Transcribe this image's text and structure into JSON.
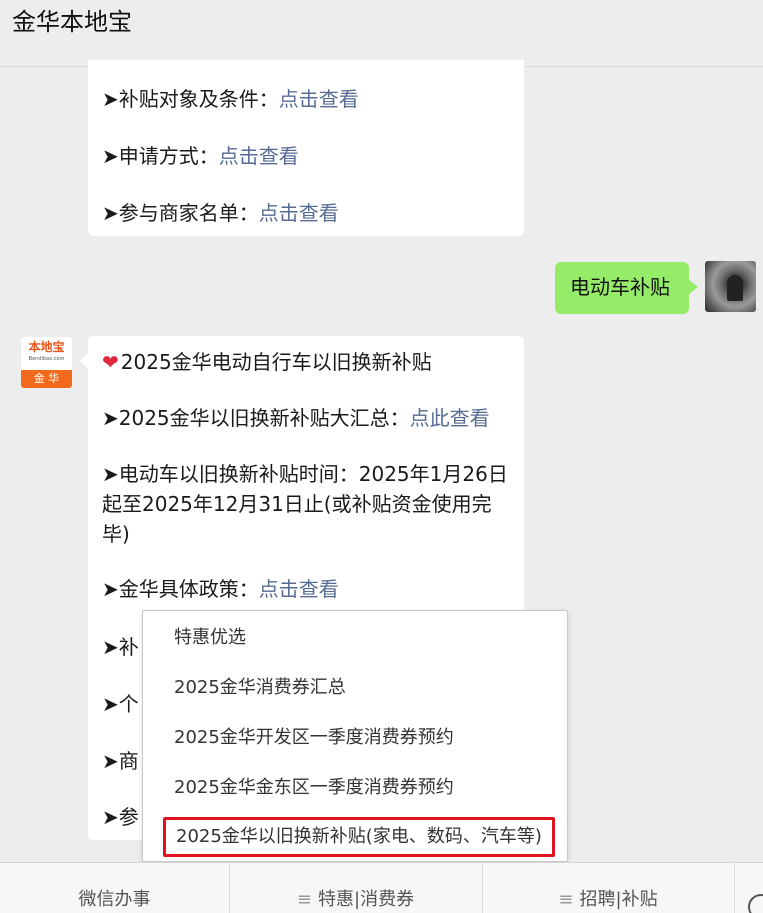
{
  "header": {
    "title": "金华本地宝"
  },
  "bubble1": {
    "lines": [
      {
        "prefix": "➤补贴对象及条件：",
        "link": "点击查看"
      },
      {
        "prefix": "➤申请方式：",
        "link": "点击查看"
      },
      {
        "prefix": "➤参与商家名单：",
        "link": "点击查看"
      }
    ]
  },
  "user_message": {
    "text": "电动车补贴"
  },
  "bot_avatar": {
    "logo_top": "本地宝",
    "logo_mid": "Bendibao.com",
    "logo_bottom": "金 华"
  },
  "bubble2": {
    "heading": "2025金华电动自行车以旧换新补贴",
    "heart": "❤",
    "line1": {
      "prefix": "➤2025金华以旧换新补贴大汇总：",
      "link": "点此查看"
    },
    "line2": "➤电动车以旧换新补贴时间：2025年1月26日起至2025年12月31日止(或补贴资金使用完毕)",
    "line3": {
      "prefix": "➤金华具体政策：",
      "link": "点击查看"
    },
    "partial_lines": [
      "➤补",
      "➤个",
      "➤商",
      "➤参"
    ]
  },
  "menu": {
    "items": [
      "特惠优选",
      "2025金华消费券汇总",
      "2025金华开发区一季度消费券预约",
      "2025金华金东区一季度消费券预约",
      "2025金华以旧换新补贴(家电、数码、汽车等)"
    ]
  },
  "bottombar": {
    "tabs": [
      "微信办事",
      "特惠|消费券",
      "招聘|补贴"
    ],
    "menu_glyph": "≡"
  },
  "colors": {
    "link": "#576b95",
    "user_bubble": "#95ec69",
    "highlight_border": "#e0141e",
    "logo_orange": "#f26b1d"
  }
}
